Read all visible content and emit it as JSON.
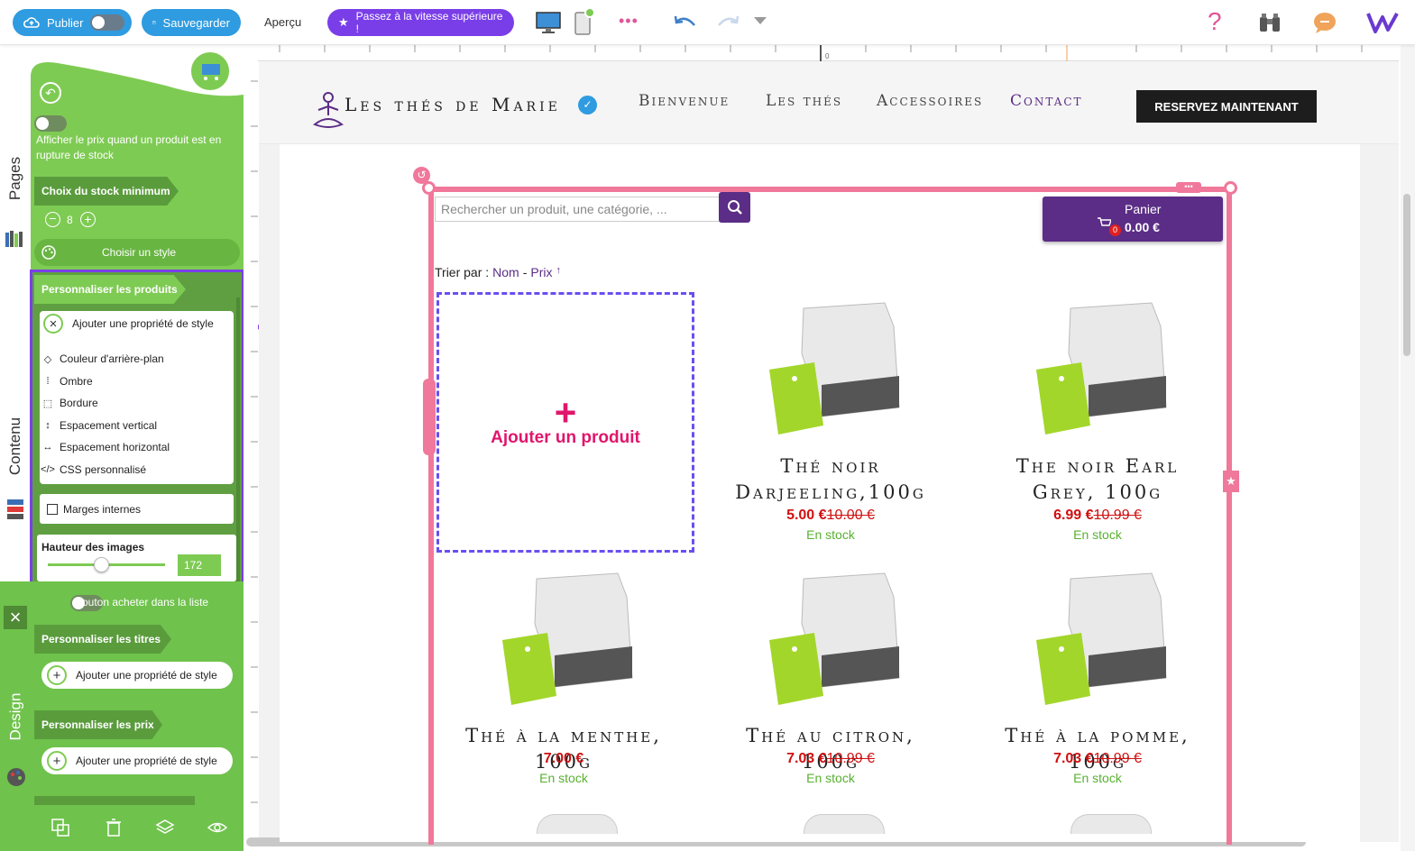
{
  "toolbar": {
    "publish_label": "Publier",
    "save_label": "Sauvegarder",
    "preview_label": "Aperçu",
    "upgrade_label": "Passez à la vitesse supérieure !",
    "more_dots": "•••",
    "help_symbol": "?",
    "colors": {
      "publish": "#2f9be0",
      "upgrade": "#7a3ee8"
    }
  },
  "left_tabs": {
    "pages": "Pages",
    "content": "Contenu",
    "design": "Design"
  },
  "panel": {
    "show_price_label": "Afficher le prix quand un produit est en rupture de stock",
    "min_stock_title": "Choix du stock minimum",
    "min_stock_value": "8",
    "choose_style_label": "Choisir un style",
    "customize_products_title": "Personnaliser les produits",
    "add_style_property_label": "Ajouter une propriété de style",
    "style_properties": [
      "Couleur d'arrière-plan",
      "Ombre",
      "Bordure",
      "Espacement vertical",
      "Espacement horizontal",
      "CSS personnalisé"
    ],
    "inner_margins_label": "Marges internes",
    "image_height_label": "Hauteur des images",
    "image_height_value": "172",
    "image_height_fraction": 0.45,
    "buy_button_label": "Bouton acheter dans la liste",
    "customize_titles_title": "Personnaliser les titres",
    "customize_titles_add": "Ajouter une propriété de style",
    "customize_prices_title": "Personnaliser les prix",
    "customize_prices_add": "Ajouter une propriété de style"
  },
  "ruler": {
    "zero_label": "0"
  },
  "site": {
    "brand": "Les thés de Marie",
    "nav": [
      "Bienvenue",
      "Les thés",
      "Accessoires",
      "Contact"
    ],
    "cta_label": "RESERVEZ MAINTENANT"
  },
  "shop": {
    "search_placeholder": "Rechercher un produit, une catégorie, ...",
    "cart_label": "Panier",
    "cart_total": "0.00 €",
    "cart_count": "0",
    "sort_label": "Trier par :",
    "sort_name": "Nom",
    "sort_separator": "-",
    "sort_price": "Prix",
    "sort_arrow": "↑",
    "add_product_label": "Ajouter un produit",
    "products": [
      {
        "title": "Thé noir Darjeeling,100g",
        "price": "5.00 €",
        "old_price": "10.00 €",
        "stock": "En stock"
      },
      {
        "title": "The noir Earl Grey, 100g",
        "price": "6.99 €",
        "old_price": "10.99 €",
        "stock": "En stock"
      },
      {
        "title": "Thé à la menthe, 100g",
        "price": "7.00 €",
        "old_price": "",
        "stock": "En stock"
      },
      {
        "title": "Thé au citron, 100g",
        "price": "7.03 €",
        "old_price": "10.99 €",
        "stock": "En stock"
      },
      {
        "title": "Thé à la pomme, 100g",
        "price": "7.03 €",
        "old_price": "10.99 €",
        "stock": "En stock"
      }
    ]
  }
}
